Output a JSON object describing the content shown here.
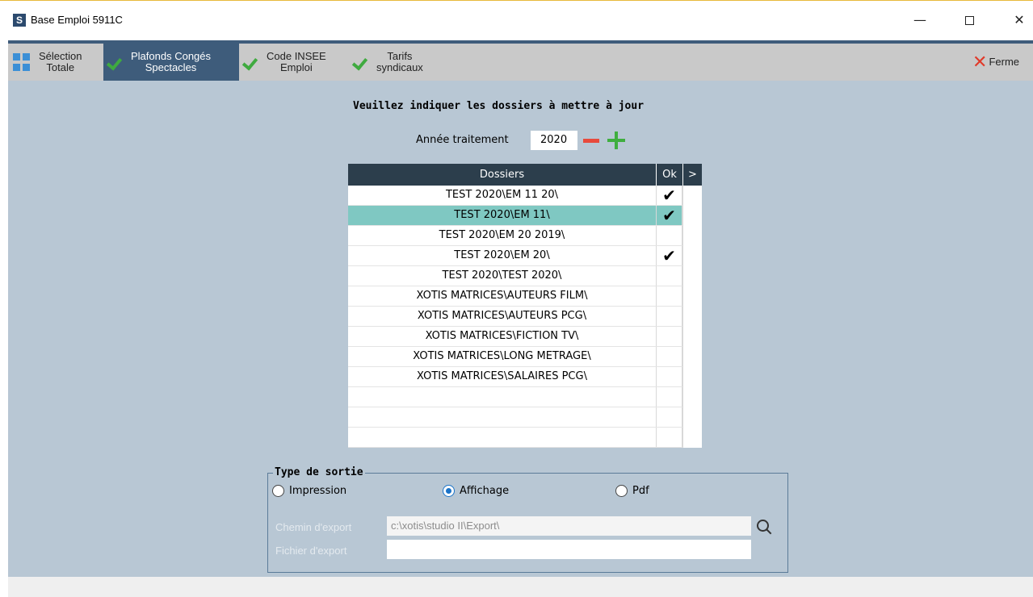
{
  "window": {
    "app_icon_letter": "S",
    "title": "Base Emploi 5911C",
    "minimize": "—",
    "close": "✕"
  },
  "toolbar": {
    "selection_label": "Sélection\nTotale",
    "plafonds_label": "Plafonds Congés\nSpectacles",
    "insee_label": "Code INSEE\nEmploi",
    "tarifs_label": "Tarifs\nsyndicaux",
    "close_label": "Ferme"
  },
  "form": {
    "heading": "Veuillez indiquer les dossiers à mettre à jour",
    "annee_label": "Année traitement",
    "annee_value": "2020"
  },
  "table": {
    "header_dossiers": "Dossiers",
    "header_ok": "Ok",
    "header_arrow": ">",
    "rows": [
      {
        "name": "TEST 2020\\EM 11 20\\",
        "ok": "✔"
      },
      {
        "name": "TEST 2020\\EM 11\\",
        "ok": "✔"
      },
      {
        "name": "TEST 2020\\EM 20 2019\\",
        "ok": ""
      },
      {
        "name": "TEST 2020\\EM 20\\",
        "ok": "✔"
      },
      {
        "name": "TEST 2020\\TEST 2020\\",
        "ok": ""
      },
      {
        "name": "XOTIS MATRICES\\AUTEURS FILM\\",
        "ok": ""
      },
      {
        "name": "XOTIS MATRICES\\AUTEURS PCG\\",
        "ok": ""
      },
      {
        "name": "XOTIS MATRICES\\FICTION TV\\",
        "ok": ""
      },
      {
        "name": "XOTIS MATRICES\\LONG METRAGE\\",
        "ok": ""
      },
      {
        "name": "XOTIS MATRICES\\SALAIRES PCG\\",
        "ok": ""
      },
      {
        "name": "",
        "ok": ""
      },
      {
        "name": "",
        "ok": ""
      },
      {
        "name": "",
        "ok": ""
      }
    ]
  },
  "output": {
    "legend": "Type de sortie",
    "impression": "Impression",
    "affichage": "Affichage",
    "pdf": "Pdf",
    "chemin_label": "Chemin d'export",
    "chemin_value": "c:\\xotis\\studio II\\Export\\",
    "fichier_label": "Fichier d'export",
    "fichier_value": ""
  },
  "colors": {
    "toolbar_active": "#3e5c7b",
    "panel_bg": "#b8c7d4",
    "row_selected": "#7fc8c2",
    "table_header": "#2c3e4c"
  }
}
